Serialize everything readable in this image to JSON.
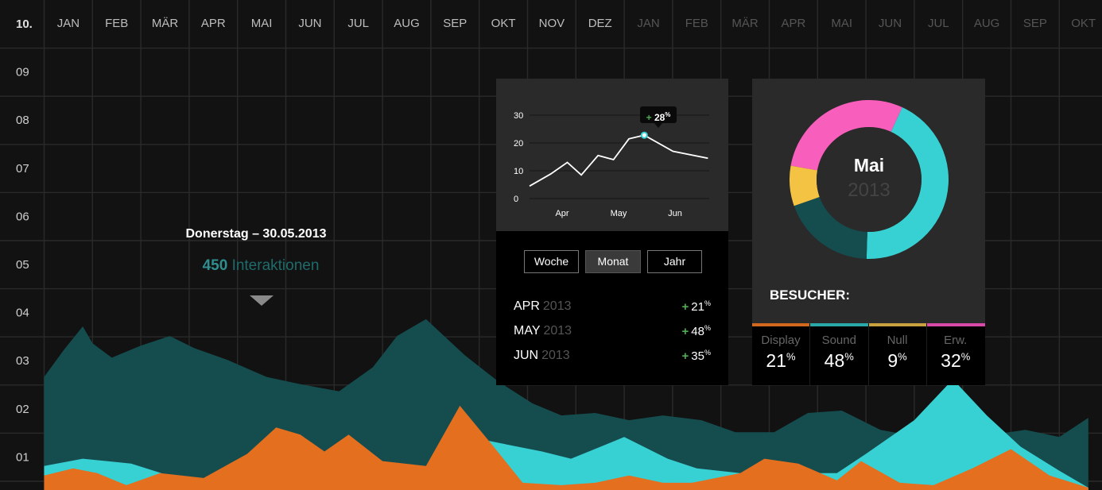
{
  "chart_data": [
    {
      "type": "area",
      "x_labels": [
        "JAN",
        "FEB",
        "MÄR",
        "APR",
        "MAI",
        "JUN",
        "JUL",
        "AUG",
        "SEP",
        "OKT",
        "NOV",
        "DEZ",
        "JAN",
        "FEB",
        "MÄR",
        "APR",
        "MAI",
        "JUN",
        "JUL",
        "AUG",
        "SEP",
        "OKT"
      ],
      "y_labels": [
        "10.",
        "09",
        "08",
        "07",
        "06",
        "05",
        "04",
        "03",
        "02",
        "01"
      ],
      "ylim": [
        0,
        10
      ],
      "grid": true,
      "series": [
        {
          "color": "#154d4f",
          "x": [
            0,
            0.4,
            0.8,
            1.0,
            1.4,
            2.0,
            2.6,
            3.1,
            3.8,
            4.6,
            5.3,
            6.1,
            6.8,
            7.3,
            7.9,
            8.7,
            9.4,
            10.1,
            10.7,
            11.4,
            12.1,
            12.8,
            13.6,
            14.3,
            15.1,
            15.8,
            16.5,
            17.3,
            18.1,
            18.8,
            19.6,
            20.3,
            21.0,
            21.6
          ],
          "values": [
            2.35,
            2.9,
            3.4,
            3.05,
            2.75,
            3.0,
            3.2,
            2.95,
            2.7,
            2.35,
            2.2,
            2.05,
            2.55,
            3.2,
            3.55,
            2.8,
            2.25,
            1.8,
            1.55,
            1.6,
            1.45,
            1.55,
            1.45,
            1.2,
            1.2,
            1.6,
            1.65,
            1.25,
            1.1,
            1.1,
            1.15,
            1.25,
            1.1,
            1.5
          ]
        },
        {
          "color": "#38d1d3",
          "x": [
            0,
            0.8,
            1.8,
            2.9,
            3.5,
            4.2,
            5.1,
            6.1,
            6.9,
            7.3,
            7.9,
            8.8,
            9.8,
            10.3,
            10.9,
            12.0,
            12.9,
            13.5,
            14.4,
            15.1,
            15.7,
            16.4,
            17.0,
            18.0,
            18.8,
            19.5,
            20.2,
            21.0,
            21.6
          ],
          "values": [
            0.5,
            0.65,
            0.55,
            0.2,
            0.25,
            0.3,
            0.6,
            0.65,
            0.35,
            0.1,
            0.4,
            1.1,
            0.9,
            0.8,
            0.65,
            1.1,
            0.65,
            0.45,
            0.35,
            0.45,
            0.35,
            0.35,
            0.75,
            1.45,
            2.3,
            1.55,
            0.9,
            0.4,
            0.05
          ]
        },
        {
          "color": "#e36f1f",
          "x": [
            0,
            0.6,
            1.1,
            1.7,
            2.4,
            3.3,
            4.2,
            4.8,
            5.3,
            5.8,
            6.3,
            7.0,
            7.9,
            8.6,
            9.3,
            9.9,
            10.7,
            11.4,
            12.1,
            12.8,
            13.4,
            14.4,
            14.9,
            15.6,
            16.4,
            16.9,
            17.7,
            18.4,
            19.2,
            20.0,
            20.8,
            21.6
          ],
          "values": [
            0.3,
            0.45,
            0.35,
            0.1,
            0.35,
            0.25,
            0.75,
            1.3,
            1.15,
            0.8,
            1.15,
            0.6,
            0.5,
            1.75,
            0.9,
            0.15,
            0.1,
            0.15,
            0.3,
            0.15,
            0.15,
            0.35,
            0.65,
            0.55,
            0.2,
            0.6,
            0.15,
            0.1,
            0.45,
            0.85,
            0.3,
            0.05
          ]
        }
      ]
    },
    {
      "type": "line",
      "x_ticks": [
        "Apr",
        "May",
        "Jun"
      ],
      "y_ticks": [
        "30",
        "20",
        "10",
        "0"
      ],
      "ylim": [
        0,
        30
      ],
      "x": [
        0,
        0.3,
        0.54,
        0.74,
        0.98,
        1.2,
        1.42,
        1.64,
        2.05,
        2.55
      ],
      "values": [
        4.5,
        8.8,
        13.0,
        8.5,
        15.5,
        14.0,
        21.5,
        22.8,
        17.0,
        14.5
      ],
      "highlight_index": 7,
      "highlight_label": "28",
      "highlight_unit": "%"
    },
    {
      "type": "pie",
      "center_title": "Mai",
      "center_subtitle": "2013",
      "values": [
        32,
        48,
        21,
        9
      ],
      "colors": [
        "#f85ebb",
        "#38d1d3",
        "#154d4f",
        "#f5c344"
      ]
    }
  ],
  "tooltip": {
    "date": "Donerstag – 30.05.2013",
    "count": "450",
    "count_label": "Interaktionen"
  },
  "range_buttons": [
    {
      "label": "Woche",
      "active": false
    },
    {
      "label": "Monat",
      "active": true
    },
    {
      "label": "Jahr",
      "active": false
    }
  ],
  "stats": [
    {
      "month": "APR",
      "year": "2013",
      "value": "21",
      "unit": "%"
    },
    {
      "month": "MAY",
      "year": "2013",
      "value": "48",
      "unit": "%"
    },
    {
      "month": "JUN",
      "year": "2013",
      "value": "35",
      "unit": "%"
    }
  ],
  "visitors": {
    "title": "BESUCHER:",
    "items": [
      {
        "label": "Display",
        "value": "21",
        "unit": "%",
        "color": "#d2671e"
      },
      {
        "label": "Sound",
        "value": "48",
        "unit": "%",
        "color": "#2aa7a8"
      },
      {
        "label": "Null",
        "value": "9",
        "unit": "%",
        "color": "#c9a23f"
      },
      {
        "label": "Erw.",
        "value": "32",
        "unit": "%",
        "color": "#d74aa7"
      }
    ]
  },
  "colors": {
    "background": "#121212",
    "grid": "#2a2a2a",
    "panel": "#2a2a2a",
    "positive": "#4caf50"
  }
}
